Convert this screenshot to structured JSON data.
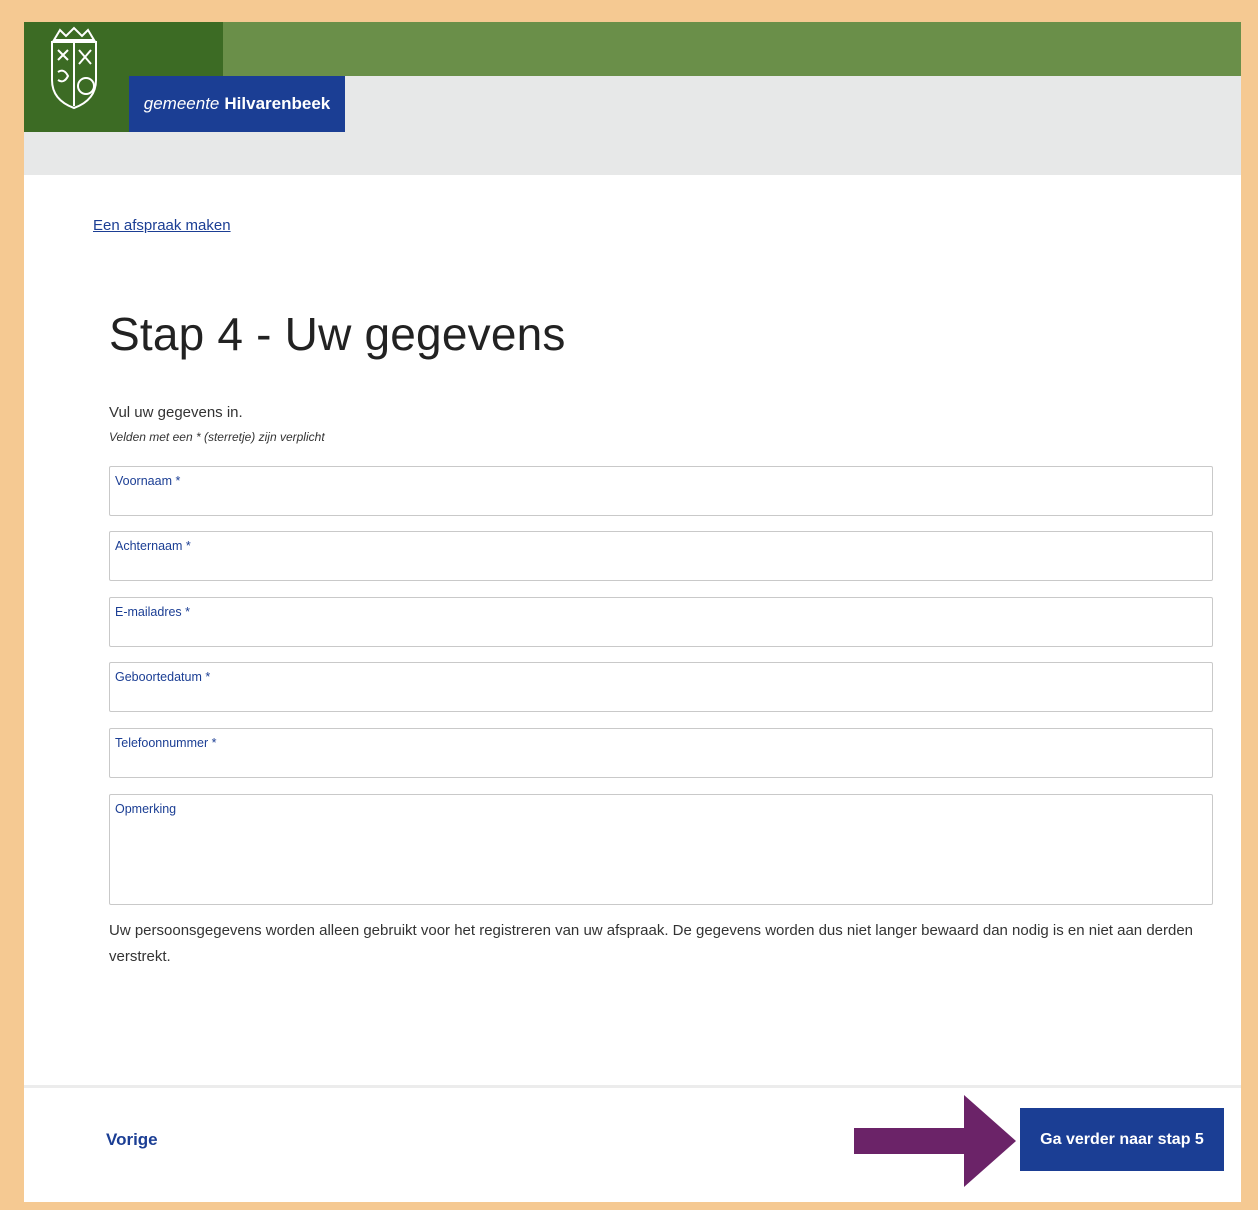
{
  "header": {
    "brand_prefix": "gemeente",
    "brand_name": "Hilvarenbeek"
  },
  "breadcrumb": {
    "link": "Een afspraak maken"
  },
  "main": {
    "title": "Stap 4 - Uw gegevens",
    "intro": "Vul uw gegevens in.",
    "required_note": "Velden met een * (sterretje) zijn verplicht",
    "fields": [
      {
        "label": "Voornaam *",
        "value": ""
      },
      {
        "label": "Achternaam *",
        "value": ""
      },
      {
        "label": "E-mailadres *",
        "value": ""
      },
      {
        "label": "Geboortedatum *",
        "value": ""
      },
      {
        "label": "Telefoonnummer *",
        "value": ""
      },
      {
        "label": "Opmerking",
        "value": ""
      }
    ],
    "privacy_text": "Uw persoonsgegevens worden alleen gebruikt voor het registreren van uw afspraak. De gegevens worden dus niet langer bewaard dan nodig is en niet aan derden verstrekt."
  },
  "footer": {
    "prev_label": "Vorige",
    "next_label": "Ga verder naar stap 5"
  },
  "colors": {
    "header_green": "#6a8f49",
    "logo_dark_green": "#3c6b24",
    "brand_blue": "#1b3e94",
    "header_grey": "#e7e8e8",
    "frame_orange": "#f5c992",
    "arrow_purple": "#6b2368"
  },
  "icons": {
    "logo": "coat-of-arms-icon",
    "pointer": "arrow-right-icon"
  }
}
